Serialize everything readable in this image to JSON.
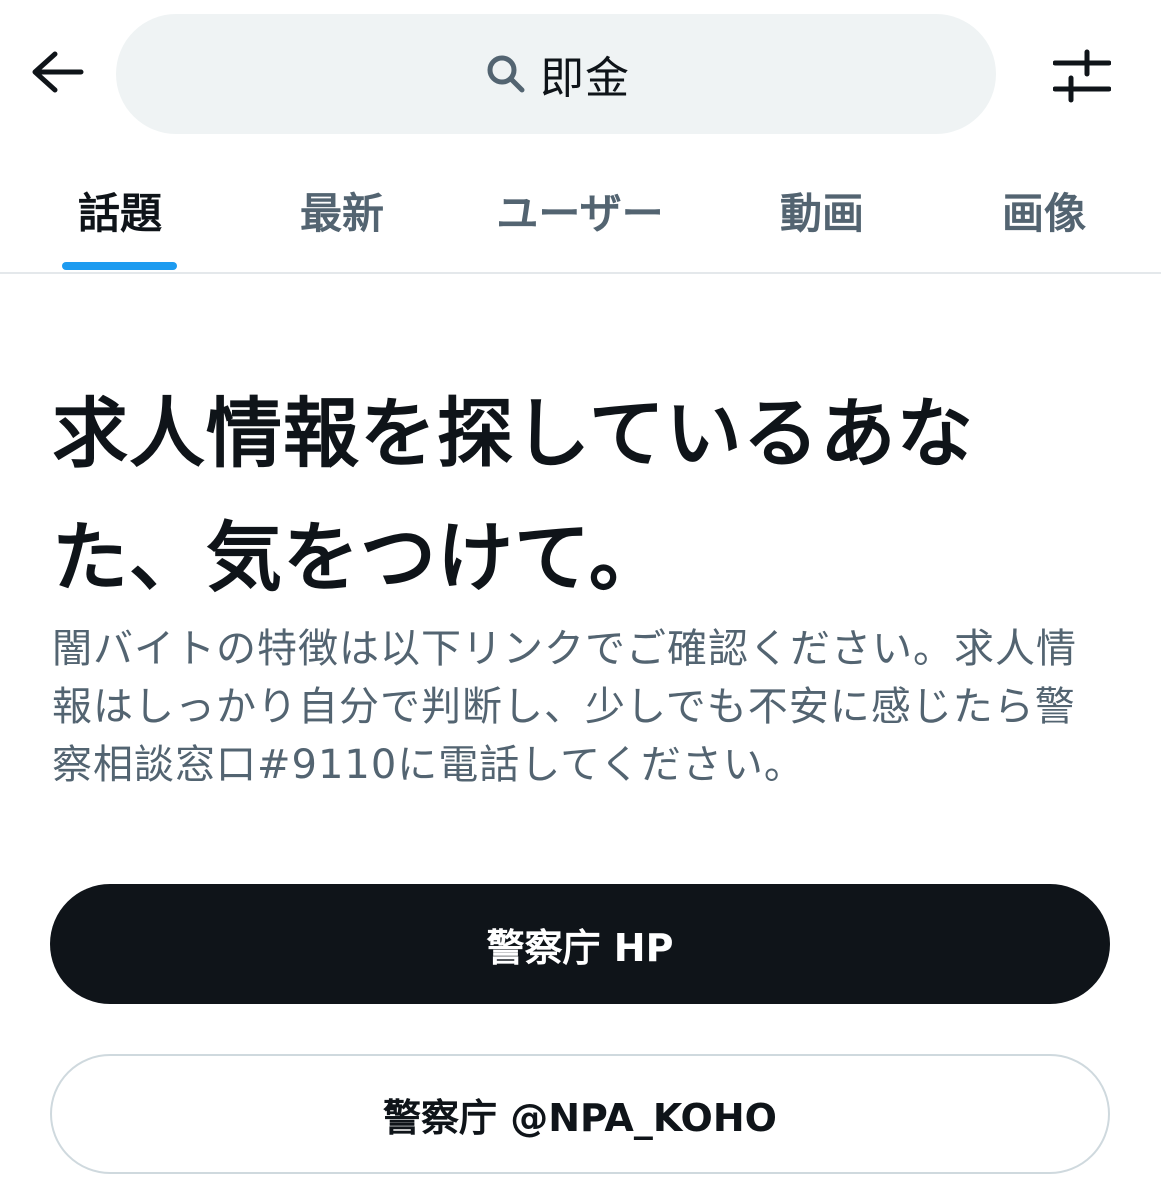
{
  "header": {
    "back_icon": "arrow-left-icon",
    "search": {
      "icon": "search-icon",
      "query": "即金"
    },
    "filter_icon": "sliders-icon"
  },
  "tabs": [
    {
      "label": "話題",
      "active": true
    },
    {
      "label": "最新",
      "active": false
    },
    {
      "label": "ユーザー",
      "active": false
    },
    {
      "label": "動画",
      "active": false
    },
    {
      "label": "画像",
      "active": false
    }
  ],
  "notice": {
    "headline": "求人情報を探しているあなた、気をつけて。",
    "description": "闇バイトの特徴は以下リンクでご確認ください。求人情報はしっかり自分で判断し、少しでも不安に感じたら警察相談窓口#9110に電話してください。",
    "primary_button": "警察庁 HP",
    "secondary_button": "警察庁 @NPA_KOHO"
  },
  "colors": {
    "accent": "#1d9bf0",
    "text_primary": "#0f1419",
    "text_secondary": "#536471",
    "search_bg": "#eff3f4"
  }
}
